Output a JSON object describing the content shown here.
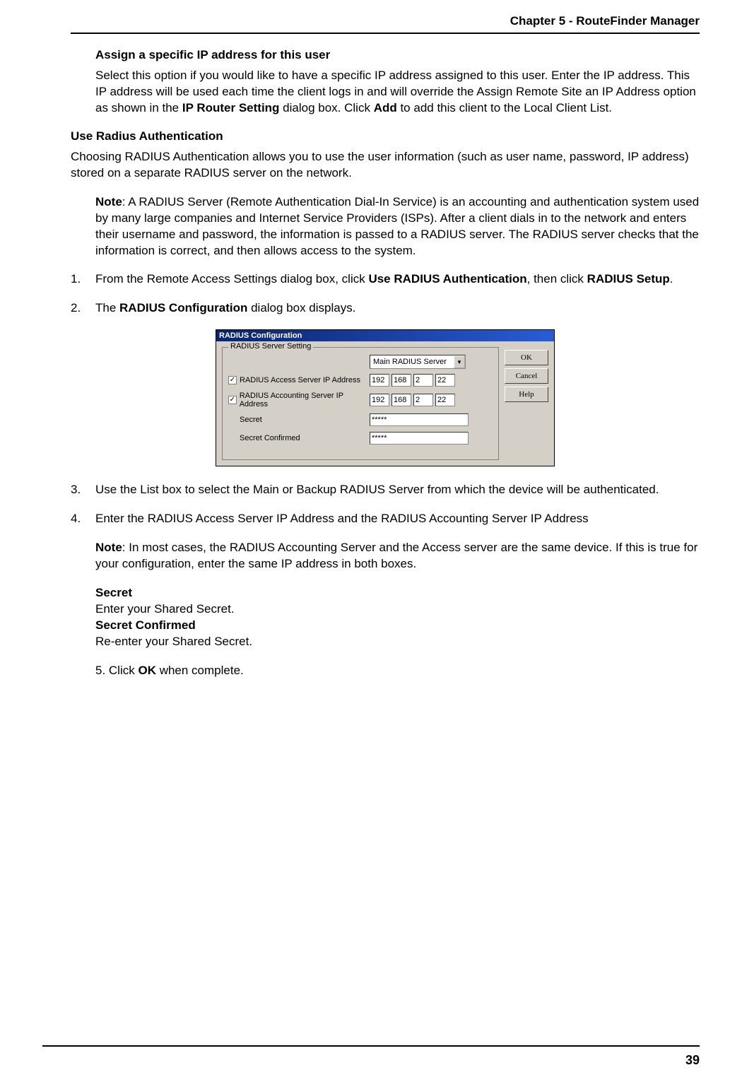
{
  "header": {
    "chapter": "Chapter 5 - RouteFinder Manager"
  },
  "footer": {
    "page": "39"
  },
  "s1": {
    "heading": "Assign a specific IP address for this user",
    "p_a": "Select this option if you would like to have a specific IP address assigned to this user.  Enter the IP address.  This IP address will be used each time the client logs in and will override the Assign Remote Site an IP Address option as shown in the ",
    "p_b": "IP Router Setting",
    "p_c": " dialog box.  Click ",
    "p_d": "Add",
    "p_e": " to add this client to the Local Client List."
  },
  "s2": {
    "heading": "Use Radius Authentication",
    "p1": "Choosing RADIUS Authentication allows you to use the user information (such as user name, password, IP address) stored on a separate RADIUS server on the network.",
    "note_label": "Note",
    "note_body": ": A RADIUS Server (Remote Authentication Dial-In Service) is an accounting and authentication system used by many large companies and Internet Service Providers (ISPs).  After a client dials in to the network and enters their username and password, the information is passed to a RADIUS server.  The RADIUS server checks that the information is correct, and then allows access to the system."
  },
  "steps": {
    "n1": "1.",
    "s1_a": "From the Remote Access Settings dialog box, click ",
    "s1_b": "Use RADIUS Authentication",
    "s1_c": ", then click ",
    "s1_d": "RADIUS Setup",
    "s1_e": ".",
    "n2": "2.",
    "s2_a": "The ",
    "s2_b": "RADIUS Configuration",
    "s2_c": " dialog box displays.",
    "n3": "3.",
    "s3": "Use the List box to select the Main or Backup RADIUS Server from which the device will be authenticated.",
    "n4": "4.",
    "s4": "Enter the RADIUS Access Server IP Address and the RADIUS Accounting Server IP Address",
    "s4_note_label": "Note",
    "s4_note_body": ": In most cases, the RADIUS Accounting Server and the Access server are the same device.  If this is true for your configuration, enter the same IP address in both boxes.",
    "secret_h": "Secret",
    "secret_t": "Enter your Shared Secret.",
    "secretc_h": "Secret Confirmed",
    "secretc_t": "Re-enter your Shared Secret.",
    "s5_a": "5. Click ",
    "s5_b": "OK",
    "s5_c": " when complete."
  },
  "dialog": {
    "title": "RADIUS Configuration",
    "group": "RADIUS Server Setting",
    "server_select": "Main RADIUS Server",
    "row_access": "RADIUS Access Server IP Address",
    "row_acct": "RADIUS Accounting Server IP Address",
    "row_secret": "Secret",
    "row_secretc": "Secret Confirmed",
    "check": "✓",
    "arrow": "▼",
    "ip": {
      "a": "192",
      "b": "168",
      "c": "2",
      "d": "22"
    },
    "mask": "*****",
    "btn_ok": "OK",
    "btn_cancel": "Cancel",
    "btn_help": "Help"
  }
}
